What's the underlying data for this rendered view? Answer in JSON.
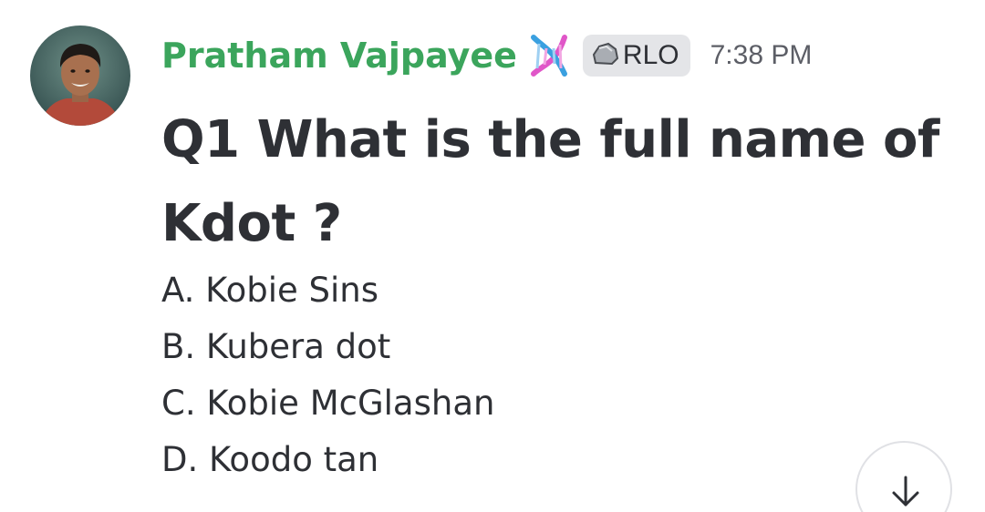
{
  "message": {
    "author": {
      "name": "Pratham Vajpayee",
      "name_color": "#3ba55c",
      "badge_icon": "dna-icon",
      "avatar_icon": "avatar"
    },
    "role_tag": {
      "icon": "rock-icon",
      "label": "RLO"
    },
    "timestamp": "7:38 PM",
    "question": "Q1 What is the full name of Kdot ?",
    "options": [
      "A. Kobie Sins",
      "B. Kubera dot",
      "C. Kobie McGlashan",
      "D. Koodo tan"
    ]
  },
  "scroll_button": {
    "icon": "arrow-down-icon"
  }
}
